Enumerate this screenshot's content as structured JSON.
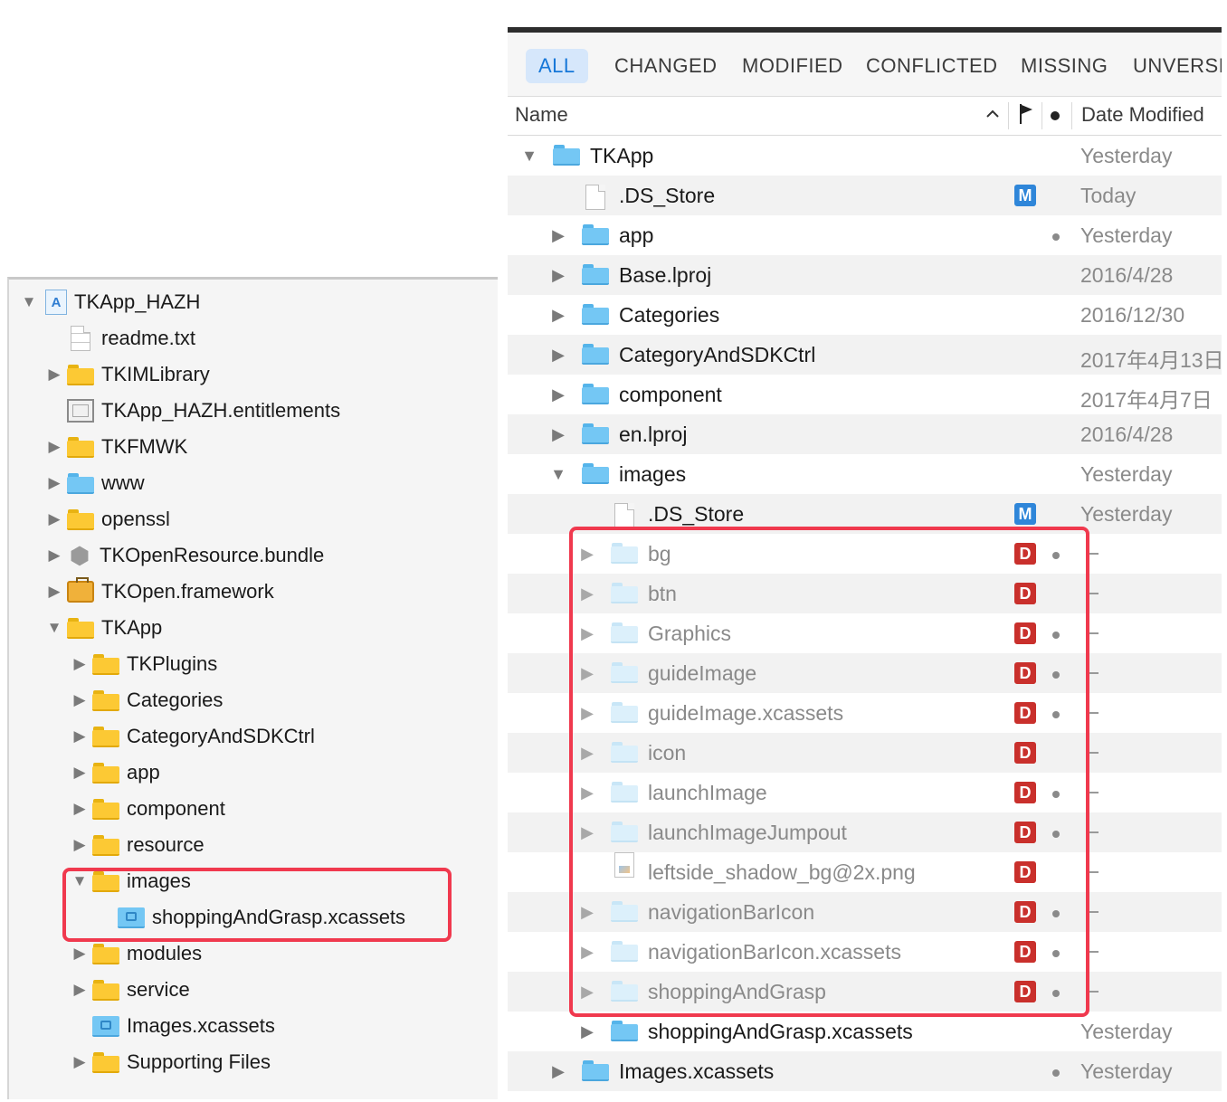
{
  "left_navigator": {
    "rows": [
      {
        "label": "TKApp_HAZH",
        "icon": "xcode-project-icon",
        "disclosure": "expanded",
        "indent": 0
      },
      {
        "label": "readme.txt",
        "icon": "text-file-icon",
        "disclosure": "none",
        "indent": 1
      },
      {
        "label": "TKIMLibrary",
        "icon": "yellow-folder-icon",
        "disclosure": "collapsed",
        "indent": 1
      },
      {
        "label": "TKApp_HAZH.entitlements",
        "icon": "entitlements-icon",
        "disclosure": "none",
        "indent": 1
      },
      {
        "label": "TKFMWK",
        "icon": "yellow-folder-icon",
        "disclosure": "collapsed",
        "indent": 1
      },
      {
        "label": "www",
        "icon": "blue-folder-icon",
        "disclosure": "collapsed",
        "indent": 1
      },
      {
        "label": "openssl",
        "icon": "yellow-folder-icon",
        "disclosure": "collapsed",
        "indent": 1
      },
      {
        "label": "TKOpenResource.bundle",
        "icon": "bundle-icon",
        "disclosure": "collapsed",
        "indent": 1
      },
      {
        "label": "TKOpen.framework",
        "icon": "framework-icon",
        "disclosure": "collapsed",
        "indent": 1
      },
      {
        "label": "TKApp",
        "icon": "yellow-folder-icon",
        "disclosure": "expanded",
        "indent": 1
      },
      {
        "label": "TKPlugins",
        "icon": "yellow-folder-icon",
        "disclosure": "collapsed",
        "indent": 2
      },
      {
        "label": "Categories",
        "icon": "yellow-folder-icon",
        "disclosure": "collapsed",
        "indent": 2
      },
      {
        "label": "CategoryAndSDKCtrl",
        "icon": "yellow-folder-icon",
        "disclosure": "collapsed",
        "indent": 2
      },
      {
        "label": "app",
        "icon": "yellow-folder-icon",
        "disclosure": "collapsed",
        "indent": 2
      },
      {
        "label": "component",
        "icon": "yellow-folder-icon",
        "disclosure": "collapsed",
        "indent": 2
      },
      {
        "label": "resource",
        "icon": "yellow-folder-icon",
        "disclosure": "collapsed",
        "indent": 2
      },
      {
        "label": "images",
        "icon": "yellow-folder-icon",
        "disclosure": "expanded",
        "indent": 2
      },
      {
        "label": "shoppingAndGrasp.xcassets",
        "icon": "asset-catalog-icon",
        "disclosure": "none",
        "indent": 3
      },
      {
        "label": "modules",
        "icon": "yellow-folder-icon",
        "disclosure": "collapsed",
        "indent": 2
      },
      {
        "label": "service",
        "icon": "yellow-folder-icon",
        "disclosure": "collapsed",
        "indent": 2
      },
      {
        "label": "Images.xcassets",
        "icon": "asset-catalog-icon",
        "disclosure": "none",
        "indent": 2
      },
      {
        "label": "Supporting Files",
        "icon": "yellow-folder-icon",
        "disclosure": "collapsed",
        "indent": 2
      }
    ]
  },
  "source_control": {
    "tabs": [
      {
        "label": "ALL",
        "active": true
      },
      {
        "label": "CHANGED",
        "active": false
      },
      {
        "label": "MODIFIED",
        "active": false
      },
      {
        "label": "CONFLICTED",
        "active": false
      },
      {
        "label": "MISSING",
        "active": false
      },
      {
        "label": "UNVERSI",
        "active": false
      }
    ],
    "columns": {
      "name": "Name",
      "sort_icon": "sort-ascending-icon",
      "flag_icon": "flag-icon",
      "dot_icon": "dot-icon",
      "date": "Date Modified"
    },
    "rows": [
      {
        "name": "TKApp",
        "icon": "blue-folder-icon",
        "disclosure": "expanded",
        "indent": 0,
        "badge": "",
        "dot": false,
        "date": "Yesterday",
        "dimmed": false
      },
      {
        "name": ".DS_Store",
        "icon": "blank-file-icon",
        "disclosure": "none",
        "indent": 1,
        "badge": "M",
        "dot": false,
        "date": "Today",
        "dimmed": false
      },
      {
        "name": "app",
        "icon": "blue-folder-icon",
        "disclosure": "collapsed",
        "indent": 1,
        "badge": "",
        "dot": true,
        "date": "Yesterday",
        "dimmed": false
      },
      {
        "name": "Base.lproj",
        "icon": "blue-folder-icon",
        "disclosure": "collapsed",
        "indent": 1,
        "badge": "",
        "dot": false,
        "date": "2016/4/28",
        "dimmed": false
      },
      {
        "name": "Categories",
        "icon": "blue-folder-icon",
        "disclosure": "collapsed",
        "indent": 1,
        "badge": "",
        "dot": false,
        "date": "2016/12/30",
        "dimmed": false
      },
      {
        "name": "CategoryAndSDKCtrl",
        "icon": "blue-folder-icon",
        "disclosure": "collapsed",
        "indent": 1,
        "badge": "",
        "dot": false,
        "date": "2017年4月13日",
        "dimmed": false
      },
      {
        "name": "component",
        "icon": "blue-folder-icon",
        "disclosure": "collapsed",
        "indent": 1,
        "badge": "",
        "dot": false,
        "date": "2017年4月7日",
        "dimmed": false
      },
      {
        "name": "en.lproj",
        "icon": "blue-folder-icon",
        "disclosure": "collapsed",
        "indent": 1,
        "badge": "",
        "dot": false,
        "date": "2016/4/28",
        "dimmed": false
      },
      {
        "name": "images",
        "icon": "blue-folder-icon",
        "disclosure": "expanded",
        "indent": 1,
        "badge": "",
        "dot": false,
        "date": "Yesterday",
        "dimmed": false
      },
      {
        "name": ".DS_Store",
        "icon": "blank-file-icon",
        "disclosure": "none",
        "indent": 2,
        "badge": "M",
        "dot": false,
        "date": "Yesterday",
        "dimmed": false
      },
      {
        "name": "bg",
        "icon": "light-folder-icon",
        "disclosure": "collapsed",
        "indent": 2,
        "badge": "D",
        "dot": true,
        "date": "--",
        "dimmed": true
      },
      {
        "name": "btn",
        "icon": "light-folder-icon",
        "disclosure": "collapsed",
        "indent": 2,
        "badge": "D",
        "dot": false,
        "date": "--",
        "dimmed": true
      },
      {
        "name": "Graphics",
        "icon": "light-folder-icon",
        "disclosure": "collapsed",
        "indent": 2,
        "badge": "D",
        "dot": true,
        "date": "--",
        "dimmed": true
      },
      {
        "name": "guideImage",
        "icon": "light-folder-icon",
        "disclosure": "collapsed",
        "indent": 2,
        "badge": "D",
        "dot": true,
        "date": "--",
        "dimmed": true
      },
      {
        "name": "guideImage.xcassets",
        "icon": "light-folder-icon",
        "disclosure": "collapsed",
        "indent": 2,
        "badge": "D",
        "dot": true,
        "date": "--",
        "dimmed": true
      },
      {
        "name": "icon",
        "icon": "light-folder-icon",
        "disclosure": "collapsed",
        "indent": 2,
        "badge": "D",
        "dot": false,
        "date": "--",
        "dimmed": true
      },
      {
        "name": "launchImage",
        "icon": "light-folder-icon",
        "disclosure": "collapsed",
        "indent": 2,
        "badge": "D",
        "dot": true,
        "date": "--",
        "dimmed": true
      },
      {
        "name": "launchImageJumpout",
        "icon": "light-folder-icon",
        "disclosure": "collapsed",
        "indent": 2,
        "badge": "D",
        "dot": true,
        "date": "--",
        "dimmed": true
      },
      {
        "name": "leftside_shadow_bg@2x.png",
        "icon": "png-file-icon",
        "disclosure": "none",
        "indent": 2,
        "badge": "D",
        "dot": false,
        "date": "--",
        "dimmed": true
      },
      {
        "name": "navigationBarIcon",
        "icon": "light-folder-icon",
        "disclosure": "collapsed",
        "indent": 2,
        "badge": "D",
        "dot": true,
        "date": "--",
        "dimmed": true
      },
      {
        "name": "navigationBarIcon.xcassets",
        "icon": "light-folder-icon",
        "disclosure": "collapsed",
        "indent": 2,
        "badge": "D",
        "dot": true,
        "date": "--",
        "dimmed": true
      },
      {
        "name": "shoppingAndGrasp",
        "icon": "light-folder-icon",
        "disclosure": "collapsed",
        "indent": 2,
        "badge": "D",
        "dot": true,
        "date": "--",
        "dimmed": true
      },
      {
        "name": "shoppingAndGrasp.xcassets",
        "icon": "blue-folder-icon",
        "disclosure": "collapsed",
        "indent": 2,
        "badge": "",
        "dot": false,
        "date": "Yesterday",
        "dimmed": false
      },
      {
        "name": "Images.xcassets",
        "icon": "blue-folder-icon",
        "disclosure": "collapsed",
        "indent": 1,
        "badge": "",
        "dot": true,
        "date": "Yesterday",
        "dimmed": false
      }
    ]
  },
  "colors": {
    "highlight_box": "#f0394e",
    "active_tab_text": "#1677d8",
    "modified_badge": "#2f86d9",
    "deleted_badge": "#c9302c"
  }
}
